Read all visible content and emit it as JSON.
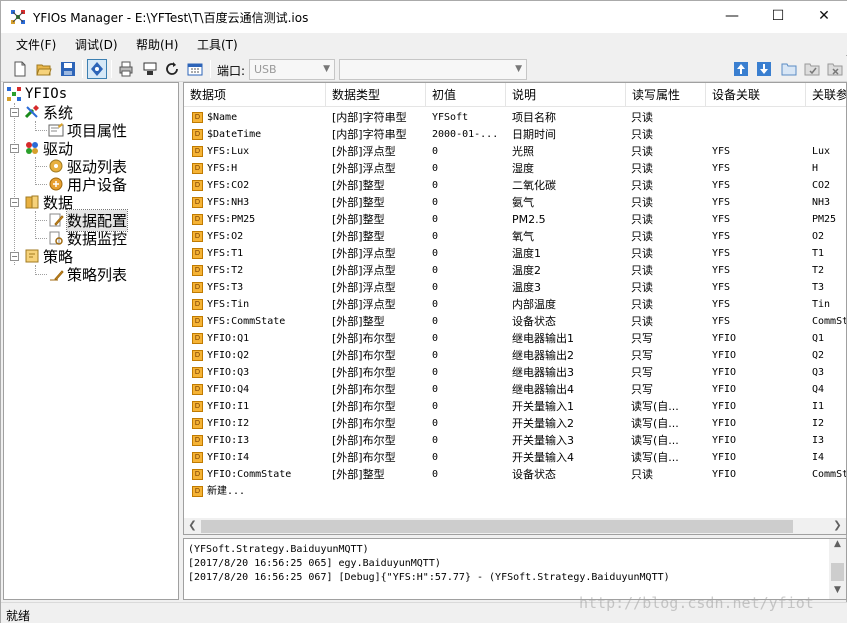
{
  "window": {
    "title": "YFIOs Manager - E:\\YFTest\\T\\百度云通信测试.ios",
    "minimize_glyph": "—",
    "maximize_glyph": "☐",
    "close_glyph": "✕"
  },
  "menu": [
    "文件(F)",
    "调试(D)",
    "帮助(H)",
    "工具(T)"
  ],
  "toolbar": {
    "icons": [
      "new-file-icon",
      "open-folder-icon",
      "save-icon",
      "debug-icon",
      "print-icon",
      "print-preview-icon",
      "refresh-icon",
      "calendar-icon"
    ],
    "port_label": "端口:",
    "port_value": "USB",
    "second_combo_value": "",
    "right_icons": [
      "move-up-icon",
      "move-down-icon",
      "folder-icon",
      "folder-check-icon",
      "folder-delete-icon"
    ]
  },
  "tree": {
    "root": "YFIOs",
    "nodes": [
      {
        "label": "系统",
        "icon": "tools-icon",
        "children": [
          {
            "label": "项目属性",
            "icon": "project-properties-icon"
          }
        ]
      },
      {
        "label": "驱动",
        "icon": "driver-icon",
        "children": [
          {
            "label": "驱动列表",
            "icon": "driver-list-icon"
          },
          {
            "label": "用户设备",
            "icon": "user-device-icon"
          }
        ]
      },
      {
        "label": "数据",
        "icon": "database-icon",
        "children": [
          {
            "label": "数据配置",
            "icon": "data-config-icon",
            "selected": true
          },
          {
            "label": "数据监控",
            "icon": "data-monitor-icon"
          }
        ]
      },
      {
        "label": "策略",
        "icon": "strategy-icon",
        "children": [
          {
            "label": "策略列表",
            "icon": "strategy-list-icon"
          }
        ]
      }
    ]
  },
  "table": {
    "columns": [
      "数据项",
      "数据类型",
      "初值",
      "说明",
      "读写属性",
      "设备关联",
      "关联参"
    ],
    "rows": [
      [
        "$Name",
        "[内部]字符串型",
        "YFSoft",
        "项目名称",
        "只读",
        "",
        ""
      ],
      [
        "$DateTime",
        "[内部]字符串型",
        "2000-01-...",
        "日期时间",
        "只读",
        "",
        ""
      ],
      [
        "YFS:Lux",
        "[外部]浮点型",
        "0",
        "光照",
        "只读",
        "YFS",
        "Lux"
      ],
      [
        "YFS:H",
        "[外部]浮点型",
        "0",
        "湿度",
        "只读",
        "YFS",
        "H"
      ],
      [
        "YFS:CO2",
        "[外部]整型",
        "0",
        "二氧化碳",
        "只读",
        "YFS",
        "CO2"
      ],
      [
        "YFS:NH3",
        "[外部]整型",
        "0",
        "氨气",
        "只读",
        "YFS",
        "NH3"
      ],
      [
        "YFS:PM25",
        "[外部]整型",
        "0",
        "PM2.5",
        "只读",
        "YFS",
        "PM25"
      ],
      [
        "YFS:O2",
        "[外部]整型",
        "0",
        "氧气",
        "只读",
        "YFS",
        "O2"
      ],
      [
        "YFS:T1",
        "[外部]浮点型",
        "0",
        "温度1",
        "只读",
        "YFS",
        "T1"
      ],
      [
        "YFS:T2",
        "[外部]浮点型",
        "0",
        "温度2",
        "只读",
        "YFS",
        "T2"
      ],
      [
        "YFS:T3",
        "[外部]浮点型",
        "0",
        "温度3",
        "只读",
        "YFS",
        "T3"
      ],
      [
        "YFS:Tin",
        "[外部]浮点型",
        "0",
        "内部温度",
        "只读",
        "YFS",
        "Tin"
      ],
      [
        "YFS:CommState",
        "[外部]整型",
        "0",
        "设备状态",
        "只读",
        "YFS",
        "CommSt"
      ],
      [
        "YFIO:Q1",
        "[外部]布尔型",
        "0",
        "继电器输出1",
        "只写",
        "YFIO",
        "Q1"
      ],
      [
        "YFIO:Q2",
        "[外部]布尔型",
        "0",
        "继电器输出2",
        "只写",
        "YFIO",
        "Q2"
      ],
      [
        "YFIO:Q3",
        "[外部]布尔型",
        "0",
        "继电器输出3",
        "只写",
        "YFIO",
        "Q3"
      ],
      [
        "YFIO:Q4",
        "[外部]布尔型",
        "0",
        "继电器输出4",
        "只写",
        "YFIO",
        "Q4"
      ],
      [
        "YFIO:I1",
        "[外部]布尔型",
        "0",
        "开关量输入1",
        "读写(自...",
        "YFIO",
        "I1"
      ],
      [
        "YFIO:I2",
        "[外部]布尔型",
        "0",
        "开关量输入2",
        "读写(自...",
        "YFIO",
        "I2"
      ],
      [
        "YFIO:I3",
        "[外部]布尔型",
        "0",
        "开关量输入3",
        "读写(自...",
        "YFIO",
        "I3"
      ],
      [
        "YFIO:I4",
        "[外部]布尔型",
        "0",
        "开关量输入4",
        "读写(自...",
        "YFIO",
        "I4"
      ],
      [
        "YFIO:CommState",
        "[外部]整型",
        "0",
        "设备状态",
        "只读",
        "YFIO",
        "CommSt"
      ],
      [
        "新建...",
        "",
        "",
        "",
        "",
        "",
        ""
      ]
    ]
  },
  "log": [
    "(YFSoft.Strategy.BaiduyunMQTT)",
    "[2017/8/20 16:56:25 065] egy.BaiduyunMQTT)",
    "[2017/8/20 16:56:25 067] [Debug]{\"YFS:H\":57.77} - (YFSoft.Strategy.BaiduyunMQTT)"
  ],
  "status": "就绪",
  "watermark": "http://blog.csdn.net/yfiot"
}
